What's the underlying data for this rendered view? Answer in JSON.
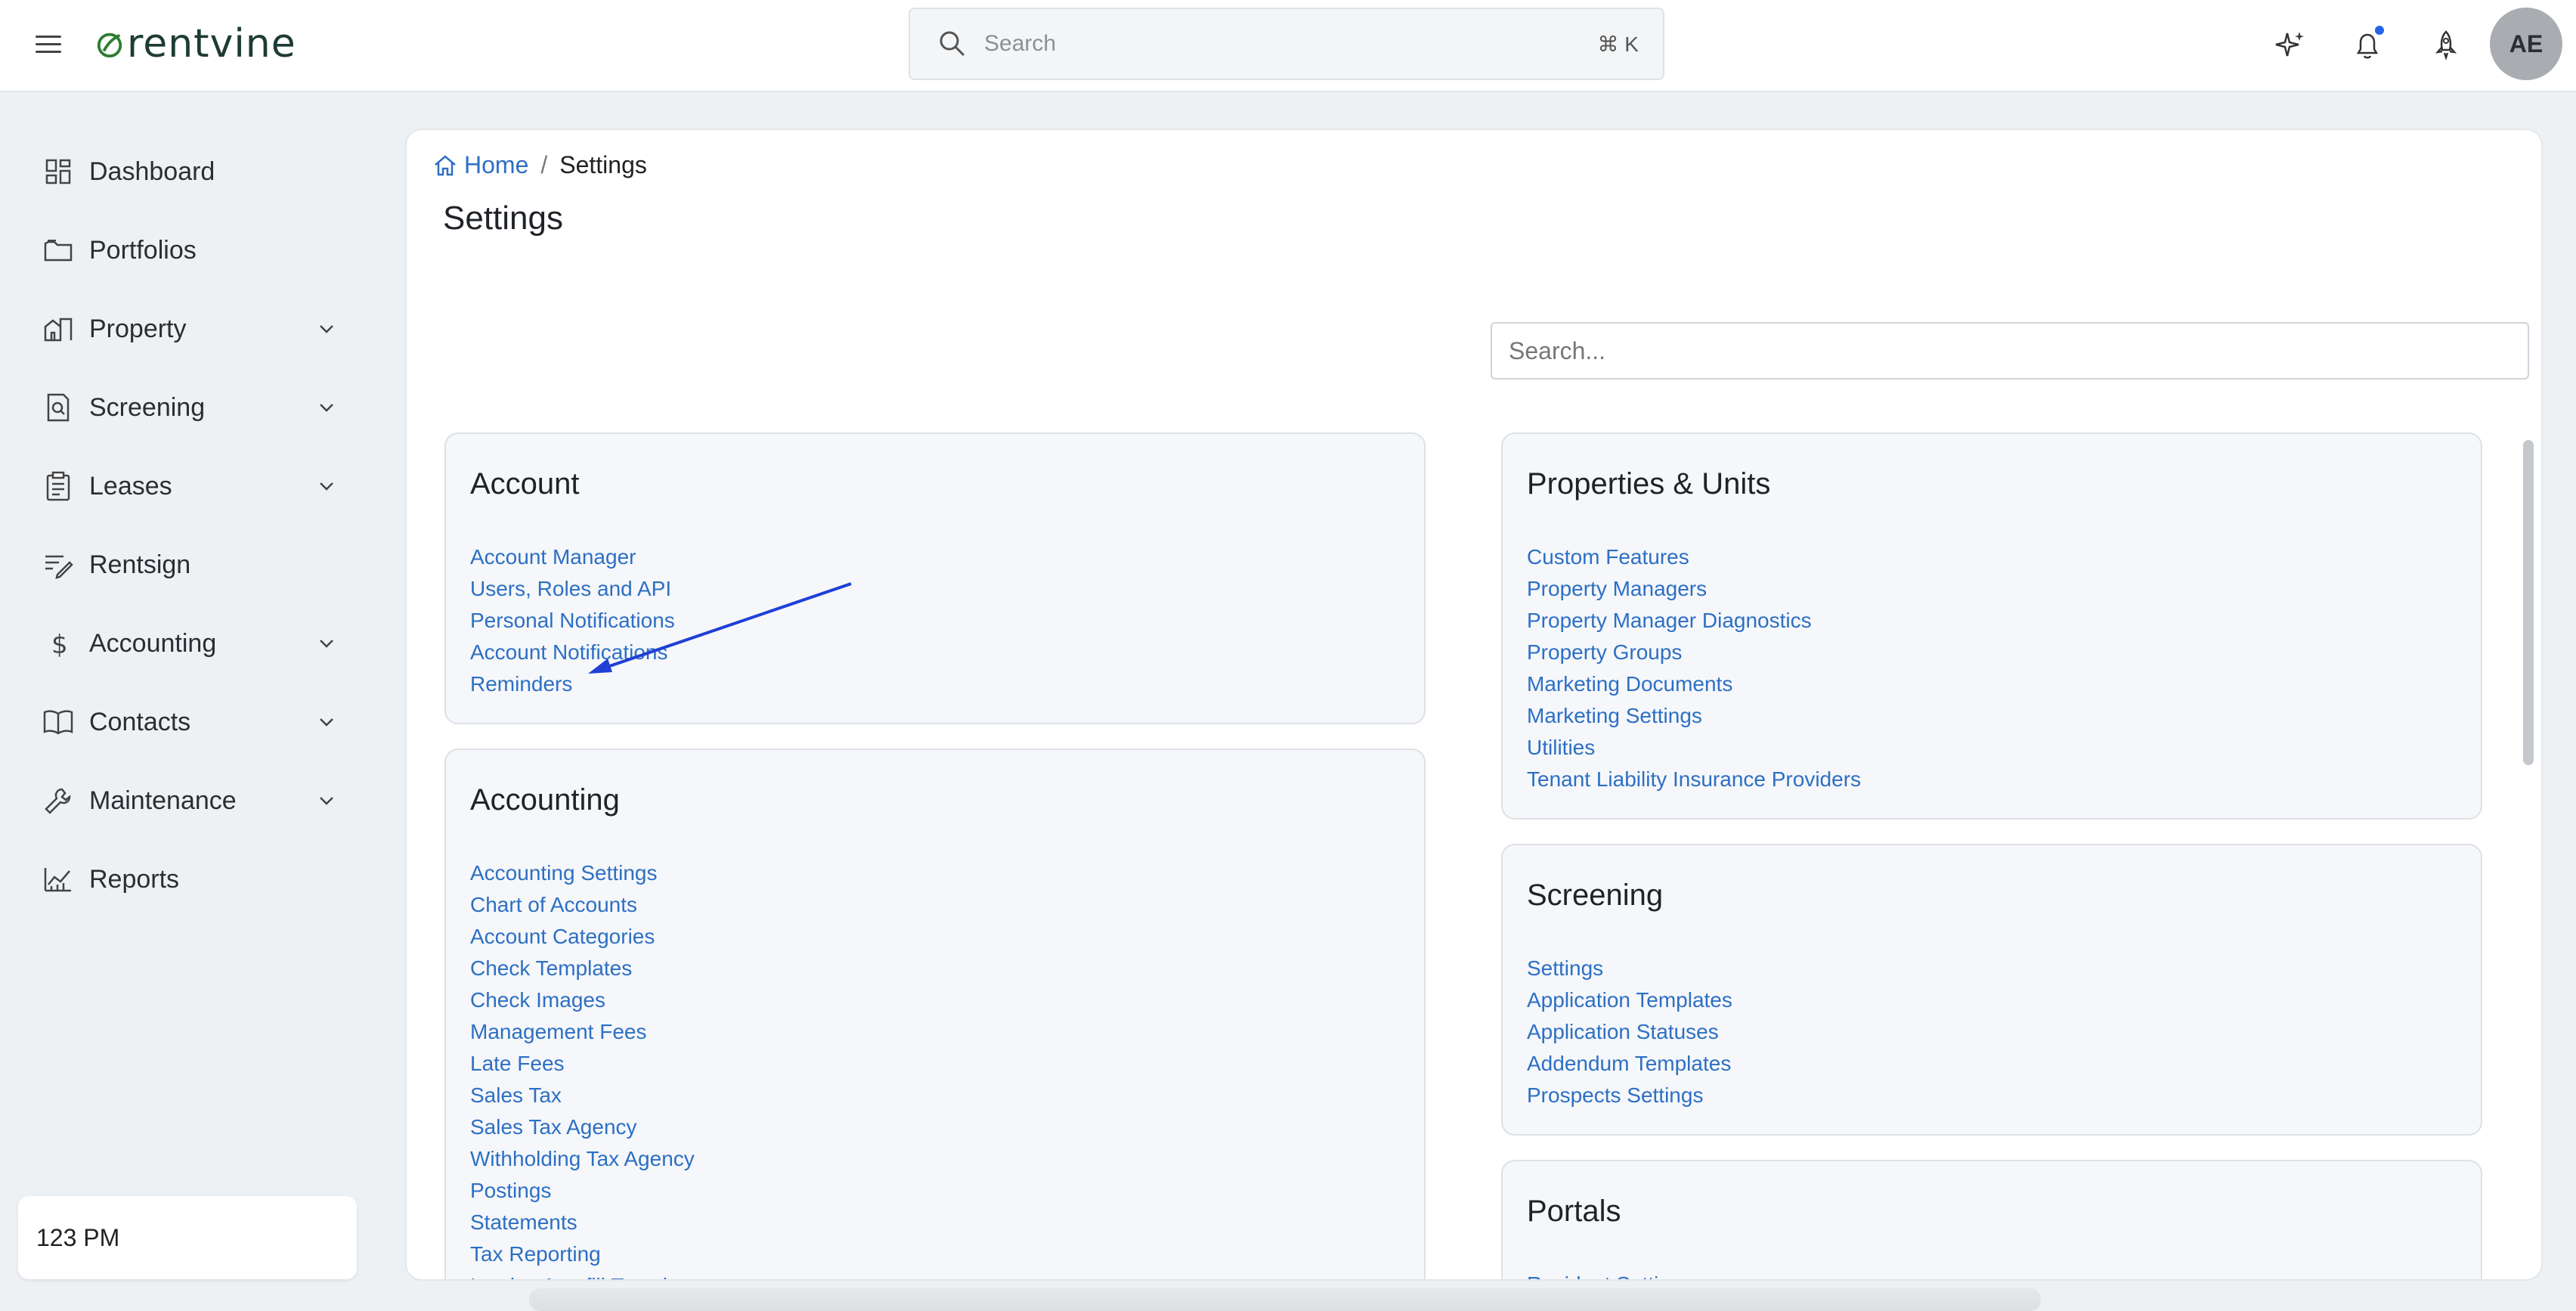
{
  "topbar": {
    "logo": "rentvine",
    "search_placeholder": "Search",
    "search_shortcut": "⌘ K",
    "avatar_initials": "AE",
    "colors": {
      "brand_green": "#2e7d32",
      "link_blue": "#2d6fc4",
      "notif_dot": "#2563eb"
    }
  },
  "sidebar": {
    "items": [
      {
        "label": "Dashboard",
        "icon": "grid-icon",
        "has_chevron": false
      },
      {
        "label": "Portfolios",
        "icon": "folder-icon",
        "has_chevron": false
      },
      {
        "label": "Property",
        "icon": "building-icon",
        "has_chevron": true
      },
      {
        "label": "Screening",
        "icon": "document-search-icon",
        "has_chevron": true
      },
      {
        "label": "Leases",
        "icon": "clipboard-icon",
        "has_chevron": true
      },
      {
        "label": "Rentsign",
        "icon": "sign-icon",
        "has_chevron": false
      },
      {
        "label": "Accounting",
        "icon": "dollar-icon",
        "has_chevron": true
      },
      {
        "label": "Contacts",
        "icon": "book-icon",
        "has_chevron": true
      },
      {
        "label": "Maintenance",
        "icon": "wrench-icon",
        "has_chevron": true
      },
      {
        "label": "Reports",
        "icon": "chart-icon",
        "has_chevron": false
      }
    ],
    "time_label": "123 PM"
  },
  "main": {
    "breadcrumb": {
      "home": "Home",
      "separator": "/",
      "current": "Settings"
    },
    "title": "Settings",
    "search_placeholder": "Search...",
    "cards": {
      "account": {
        "title": "Account",
        "links": [
          "Account Manager",
          "Users, Roles and API",
          "Personal Notifications",
          "Account Notifications",
          "Reminders"
        ]
      },
      "accounting": {
        "title": "Accounting",
        "links": [
          "Accounting Settings",
          "Chart of Accounts",
          "Account Categories",
          "Check Templates",
          "Check Images",
          "Management Fees",
          "Late Fees",
          "Sales Tax",
          "Sales Tax Agency",
          "Withholding Tax Agency",
          "Postings",
          "Statements",
          "Tax Reporting",
          "Invoice Autofill Templates"
        ]
      },
      "properties": {
        "title": "Properties & Units",
        "links": [
          "Custom Features",
          "Property Managers",
          "Property Manager Diagnostics",
          "Property Groups",
          "Marketing Documents",
          "Marketing Settings",
          "Utilities",
          "Tenant Liability Insurance Providers"
        ]
      },
      "screening": {
        "title": "Screening",
        "links": [
          "Settings",
          "Application Templates",
          "Application Statuses",
          "Addendum Templates",
          "Prospects Settings"
        ]
      },
      "portals": {
        "title": "Portals",
        "links": [
          "Resident Settings"
        ]
      }
    }
  }
}
